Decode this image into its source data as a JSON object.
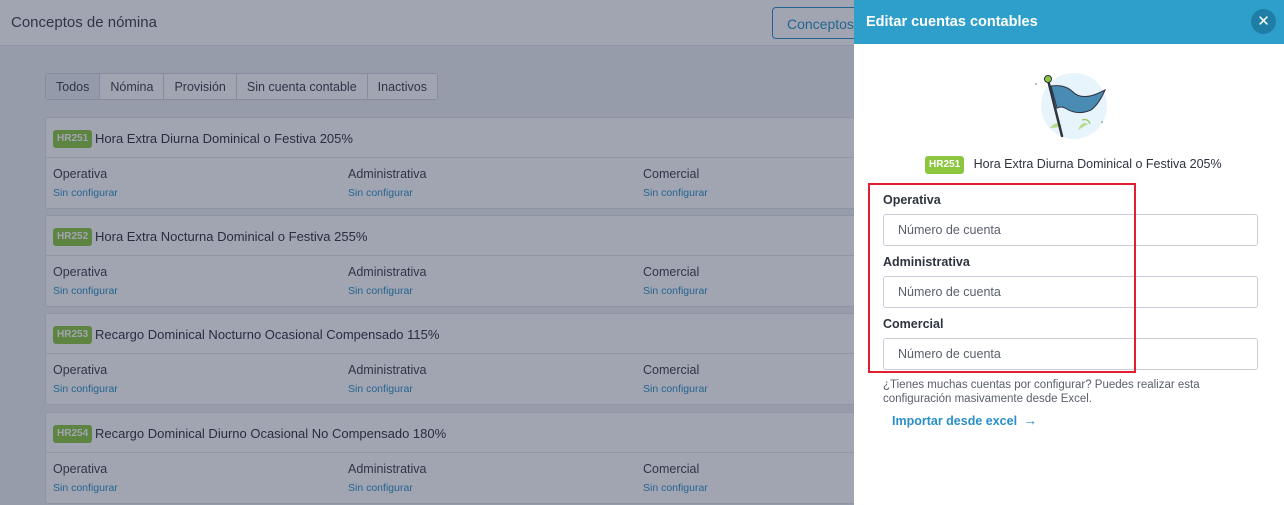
{
  "page": {
    "title": "Conceptos de nómina",
    "conceptos_button": "Conceptos",
    "tabs": [
      "Todos",
      "Nómina",
      "Provisión",
      "Sin cuenta contable",
      "Inactivos"
    ],
    "active_tab": "Todos",
    "cards": [
      {
        "code": "HR251",
        "name": "Hora Extra Diurna Dominical o Festiva 205%",
        "columns": [
          {
            "label": "Operativa",
            "value": "Sin configurar"
          },
          {
            "label": "Administrativa",
            "value": "Sin configurar"
          },
          {
            "label": "Comercial",
            "value": "Sin configurar"
          }
        ]
      },
      {
        "code": "HR252",
        "name": "Hora Extra Nocturna Dominical o Festiva 255%",
        "columns": [
          {
            "label": "Operativa",
            "value": "Sin configurar"
          },
          {
            "label": "Administrativa",
            "value": "Sin configurar"
          },
          {
            "label": "Comercial",
            "value": "Sin configurar"
          }
        ]
      },
      {
        "code": "HR253",
        "name": "Recargo Dominical Nocturno Ocasional Compensado 115%",
        "columns": [
          {
            "label": "Operativa",
            "value": "Sin configurar"
          },
          {
            "label": "Administrativa",
            "value": "Sin configurar"
          },
          {
            "label": "Comercial",
            "value": "Sin configurar"
          }
        ]
      },
      {
        "code": "HR254",
        "name": "Recargo Dominical Diurno Ocasional No Compensado 180%",
        "columns": [
          {
            "label": "Operativa",
            "value": "Sin configurar"
          },
          {
            "label": "Administrativa",
            "value": "Sin configurar"
          },
          {
            "label": "Comercial",
            "value": "Sin configurar"
          }
        ]
      }
    ]
  },
  "panel": {
    "title": "Editar cuentas contables",
    "close_icon": "close-icon",
    "illustration_icon": "flag-icon",
    "concept": {
      "code": "HR251",
      "name": "Hora Extra Diurna Dominical o Festiva 205%"
    },
    "fields": [
      {
        "label": "Operativa",
        "placeholder": "Número de cuenta",
        "value": ""
      },
      {
        "label": "Administrativa",
        "placeholder": "Número de cuenta",
        "value": ""
      },
      {
        "label": "Comercial",
        "placeholder": "Número de cuenta",
        "value": ""
      }
    ],
    "hint": "¿Tienes muchas cuentas por configurar? Puedes realizar esta configuración masivamente desde Excel.",
    "import_link": "Importar desde excel",
    "import_icon": "arrow-right-icon"
  },
  "colors": {
    "accent": "#2e9fcb",
    "badge": "#8cc63f",
    "link": "#2a8fc7",
    "highlight": "#e02030"
  }
}
